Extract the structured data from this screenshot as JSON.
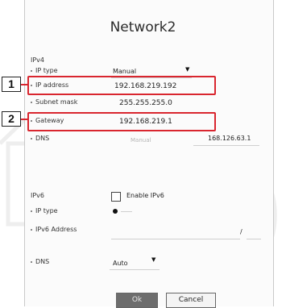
{
  "dialog": {
    "title": "Network2"
  },
  "ipv4": {
    "section": "IPv4",
    "ip_type": {
      "label": "IP type",
      "value": "Manual"
    },
    "ip_address": {
      "label": "IP address",
      "value": "192.168.219.192"
    },
    "subnet_mask": {
      "label": "Subnet mask",
      "value": "255.255.255.0"
    },
    "gateway": {
      "label": "Gateway",
      "value": "192.168.219.1"
    },
    "dns": {
      "label": "DNS",
      "mode": "Manual",
      "value": "168.126.63.1"
    }
  },
  "ipv6": {
    "section": "IPv6",
    "enable_label": "Enable IPv6",
    "ip_type": {
      "label": "IP type"
    },
    "address": {
      "label": "IPv6 Address",
      "separator": "/"
    },
    "dns": {
      "label": "DNS",
      "value": "Auto"
    }
  },
  "buttons": {
    "ok": "Ok",
    "cancel": "Cancel"
  },
  "markers": [
    "1",
    "2"
  ],
  "colors": {
    "highlight": "#d9262f",
    "ok_button": "#6d6d6d"
  }
}
